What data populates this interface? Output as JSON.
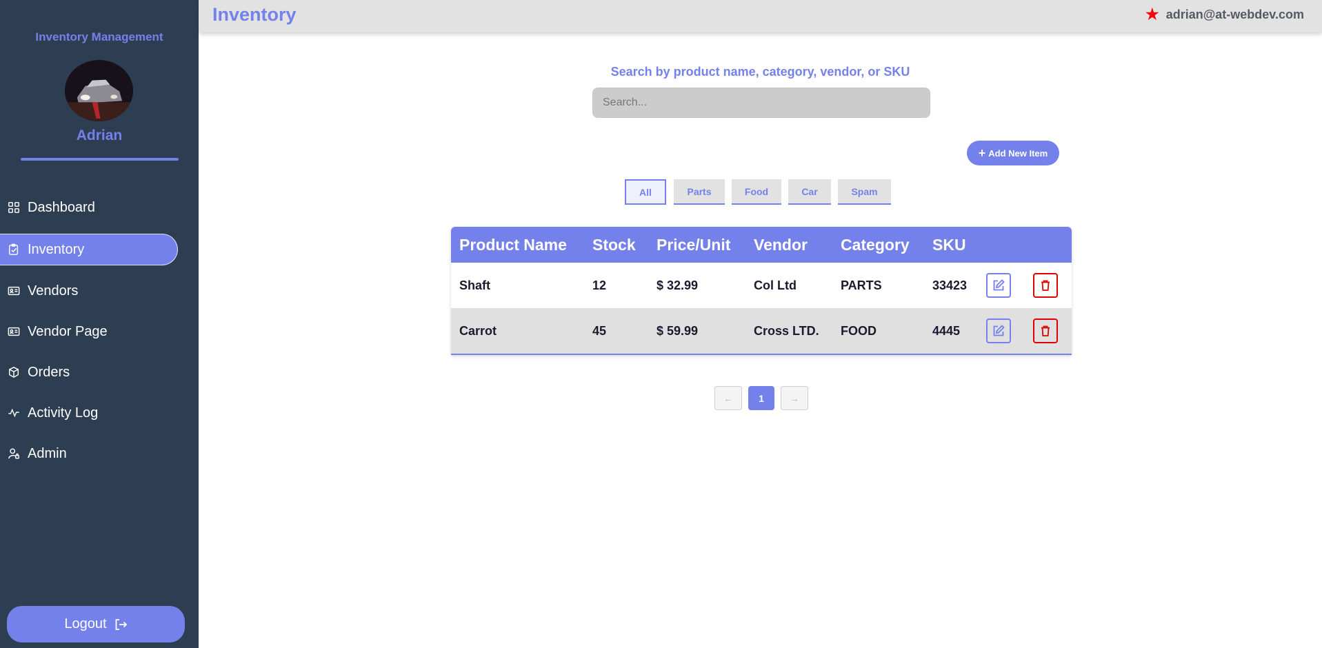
{
  "sidebar": {
    "app_title": "Inventory Management",
    "user_name": "Adrian",
    "items": [
      {
        "label": "Dashboard",
        "icon": "grid-icon"
      },
      {
        "label": "Inventory",
        "icon": "clipboard-check-icon",
        "active": true
      },
      {
        "label": "Vendors",
        "icon": "id-card-icon"
      },
      {
        "label": "Vendor Page",
        "icon": "id-card-icon"
      },
      {
        "label": "Orders",
        "icon": "box-icon"
      },
      {
        "label": "Activity Log",
        "icon": "activity-icon"
      },
      {
        "label": "Admin",
        "icon": "user-lock-icon"
      }
    ],
    "logout_label": "Logout"
  },
  "header": {
    "title": "Inventory",
    "user_email": "adrian@at-webdev.com"
  },
  "search": {
    "label": "Search by product name, category, vendor, or SKU",
    "placeholder": "Search...",
    "value": ""
  },
  "toolbar": {
    "add_label": "Add New Item"
  },
  "filters": {
    "items": [
      "All",
      "Parts",
      "Food",
      "Car",
      "Spam"
    ],
    "selected": "All"
  },
  "table": {
    "headers": [
      "Product Name",
      "Stock",
      "Price/Unit",
      "Vendor",
      "Category",
      "SKU"
    ],
    "rows": [
      {
        "name": "Shaft",
        "stock": "12",
        "price": "$ 32.99",
        "vendor": "Col Ltd",
        "category": "PARTS",
        "sku": "33423"
      },
      {
        "name": "Carrot",
        "stock": "45",
        "price": "$ 59.99",
        "vendor": "Cross LTD.",
        "category": "FOOD",
        "sku": "4445"
      }
    ]
  },
  "pagination": {
    "prev": "←",
    "current_page": "1",
    "next": "→"
  },
  "colors": {
    "accent": "#7481eb",
    "sidebar_bg": "#2e3e52",
    "danger": "#e00000",
    "star": "#f00a0a"
  }
}
